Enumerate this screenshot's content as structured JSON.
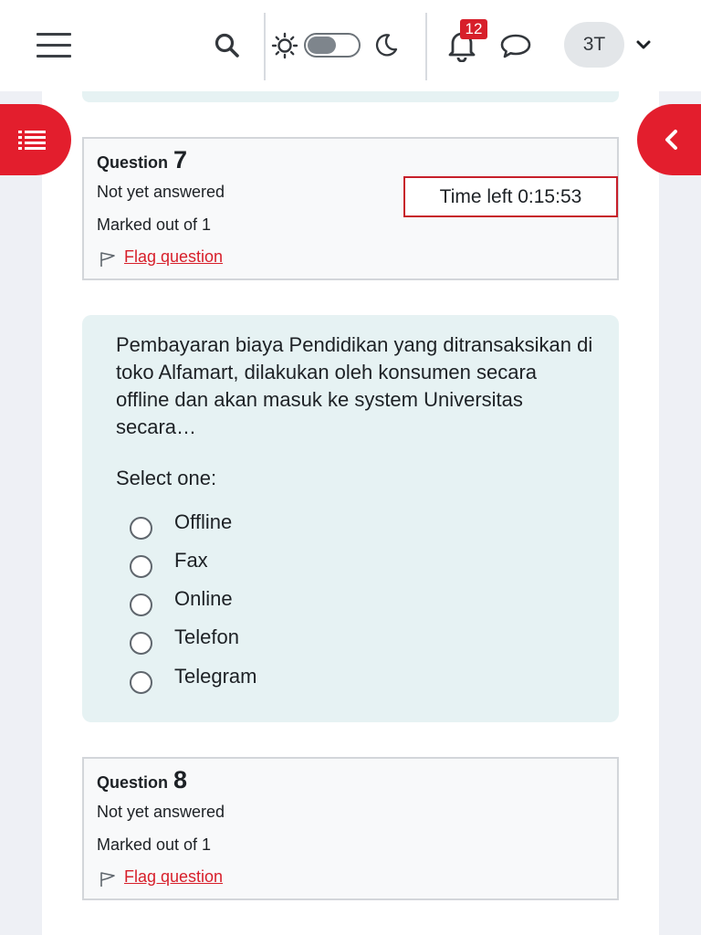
{
  "header": {
    "notifications_count": "12",
    "user_initials": "3T"
  },
  "questions": [
    {
      "label": "Question",
      "number": "7",
      "state": "Not yet answered",
      "grade": "Marked out of 1",
      "flag_label": "Flag question"
    },
    {
      "label": "Question",
      "number": "8",
      "state": "Not yet answered",
      "grade": "Marked out of 1",
      "flag_label": "Flag question"
    }
  ],
  "timer": {
    "text": "Time left 0:15:53"
  },
  "formulation": {
    "question_text": "Pembayaran biaya Pendidikan yang ditransaksikan di toko Alfamart, dilakukan oleh konsumen secara offline dan akan masuk ke system Universitas secara…",
    "prompt": "Select one:",
    "options": [
      "Offline",
      "Fax",
      "Online",
      "Telefon",
      "Telegram"
    ]
  },
  "colors": {
    "accent": "#e31e2d",
    "flag_link": "#d71f2a",
    "formulation_bg": "#e6f2f3",
    "info_bg": "#f8f9fa"
  }
}
